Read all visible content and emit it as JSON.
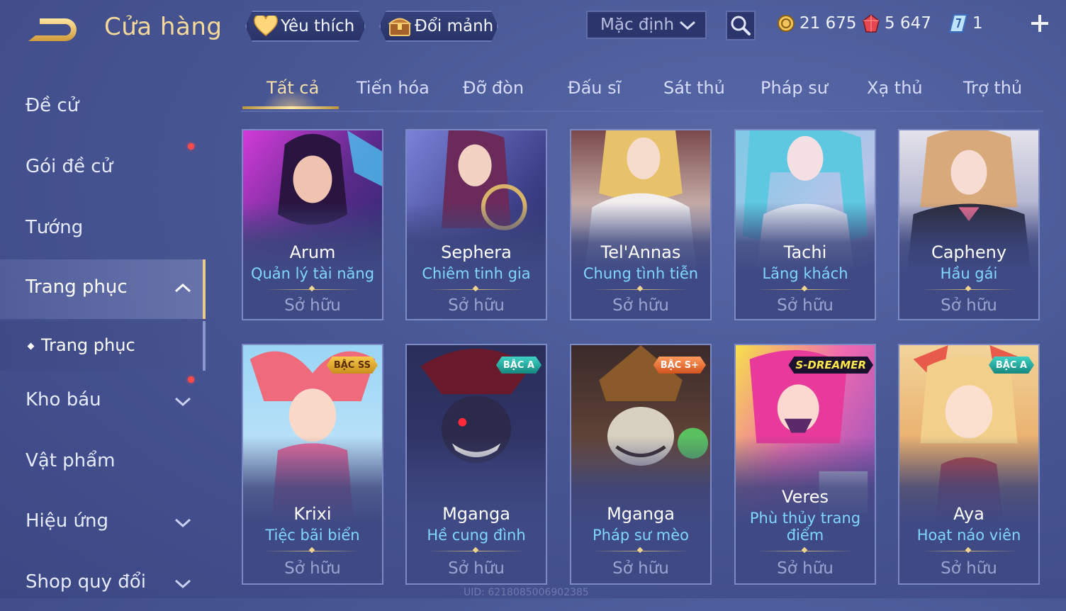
{
  "header": {
    "title": "Cửa hàng",
    "favorite_label": "Yêu thích",
    "exchange_label": "Đổi mảnh",
    "sort_value": "Mặc định",
    "currencies": [
      {
        "icon": "gold-coin-icon",
        "value": "21 675"
      },
      {
        "icon": "ruby-gem-icon",
        "value": "5 647"
      },
      {
        "icon": "voucher-icon",
        "value": "1"
      }
    ]
  },
  "sidebar": {
    "items": [
      {
        "label": "Đề cử"
      },
      {
        "label": "Gói đề cử"
      },
      {
        "label": "Tướng"
      },
      {
        "label": "Trang phục"
      },
      {
        "label": "Kho báu"
      },
      {
        "label": "Vật phẩm"
      },
      {
        "label": "Hiệu ứng"
      },
      {
        "label": "Shop quy đổi"
      }
    ],
    "sub_item": {
      "label": "Trang phục"
    }
  },
  "tabs": [
    {
      "label": "Tất cả"
    },
    {
      "label": "Tiến hóa"
    },
    {
      "label": "Đỡ đòn"
    },
    {
      "label": "Đấu sĩ"
    },
    {
      "label": "Sát thủ"
    },
    {
      "label": "Pháp sư"
    },
    {
      "label": "Xạ thủ"
    },
    {
      "label": "Trợ thủ"
    }
  ],
  "cards": [
    {
      "name": "Arum",
      "skin": "Quản lý tài năng",
      "status": "Sở hữu",
      "badge": ""
    },
    {
      "name": "Sephera",
      "skin": "Chiêm tinh gia",
      "status": "Sở hữu",
      "badge": ""
    },
    {
      "name": "Tel'Annas",
      "skin": "Chung tình tiễn",
      "status": "Sở hữu",
      "badge": ""
    },
    {
      "name": "Tachi",
      "skin": "Lãng khách",
      "status": "Sở hữu",
      "badge": ""
    },
    {
      "name": "Capheny",
      "skin": "Hầu gái",
      "status": "Sở hữu",
      "badge": ""
    },
    {
      "name": "Krixi",
      "skin": "Tiệc bãi biển",
      "status": "Sở hữu",
      "badge": "BẬC SS"
    },
    {
      "name": "Mganga",
      "skin": "Hề cung đình",
      "status": "Sở hữu",
      "badge": "BẬC A"
    },
    {
      "name": "Mganga",
      "skin": "Pháp sư mèo",
      "status": "Sở hữu",
      "badge": "BẬC S+"
    },
    {
      "name": "Veres",
      "skin": "Phù thủy trang điểm",
      "status": "Sở hữu",
      "badge": "S-DREAMER"
    },
    {
      "name": "Aya",
      "skin": "Hoạt náo viên",
      "status": "Sở hữu",
      "badge": "BẬC A"
    }
  ],
  "uid": "UID: 6218085006902385",
  "colors": {
    "accent_gold": "#f4d99a",
    "skin_name_blue": "#7fd7ff",
    "notification_red": "#ff4a4a"
  }
}
